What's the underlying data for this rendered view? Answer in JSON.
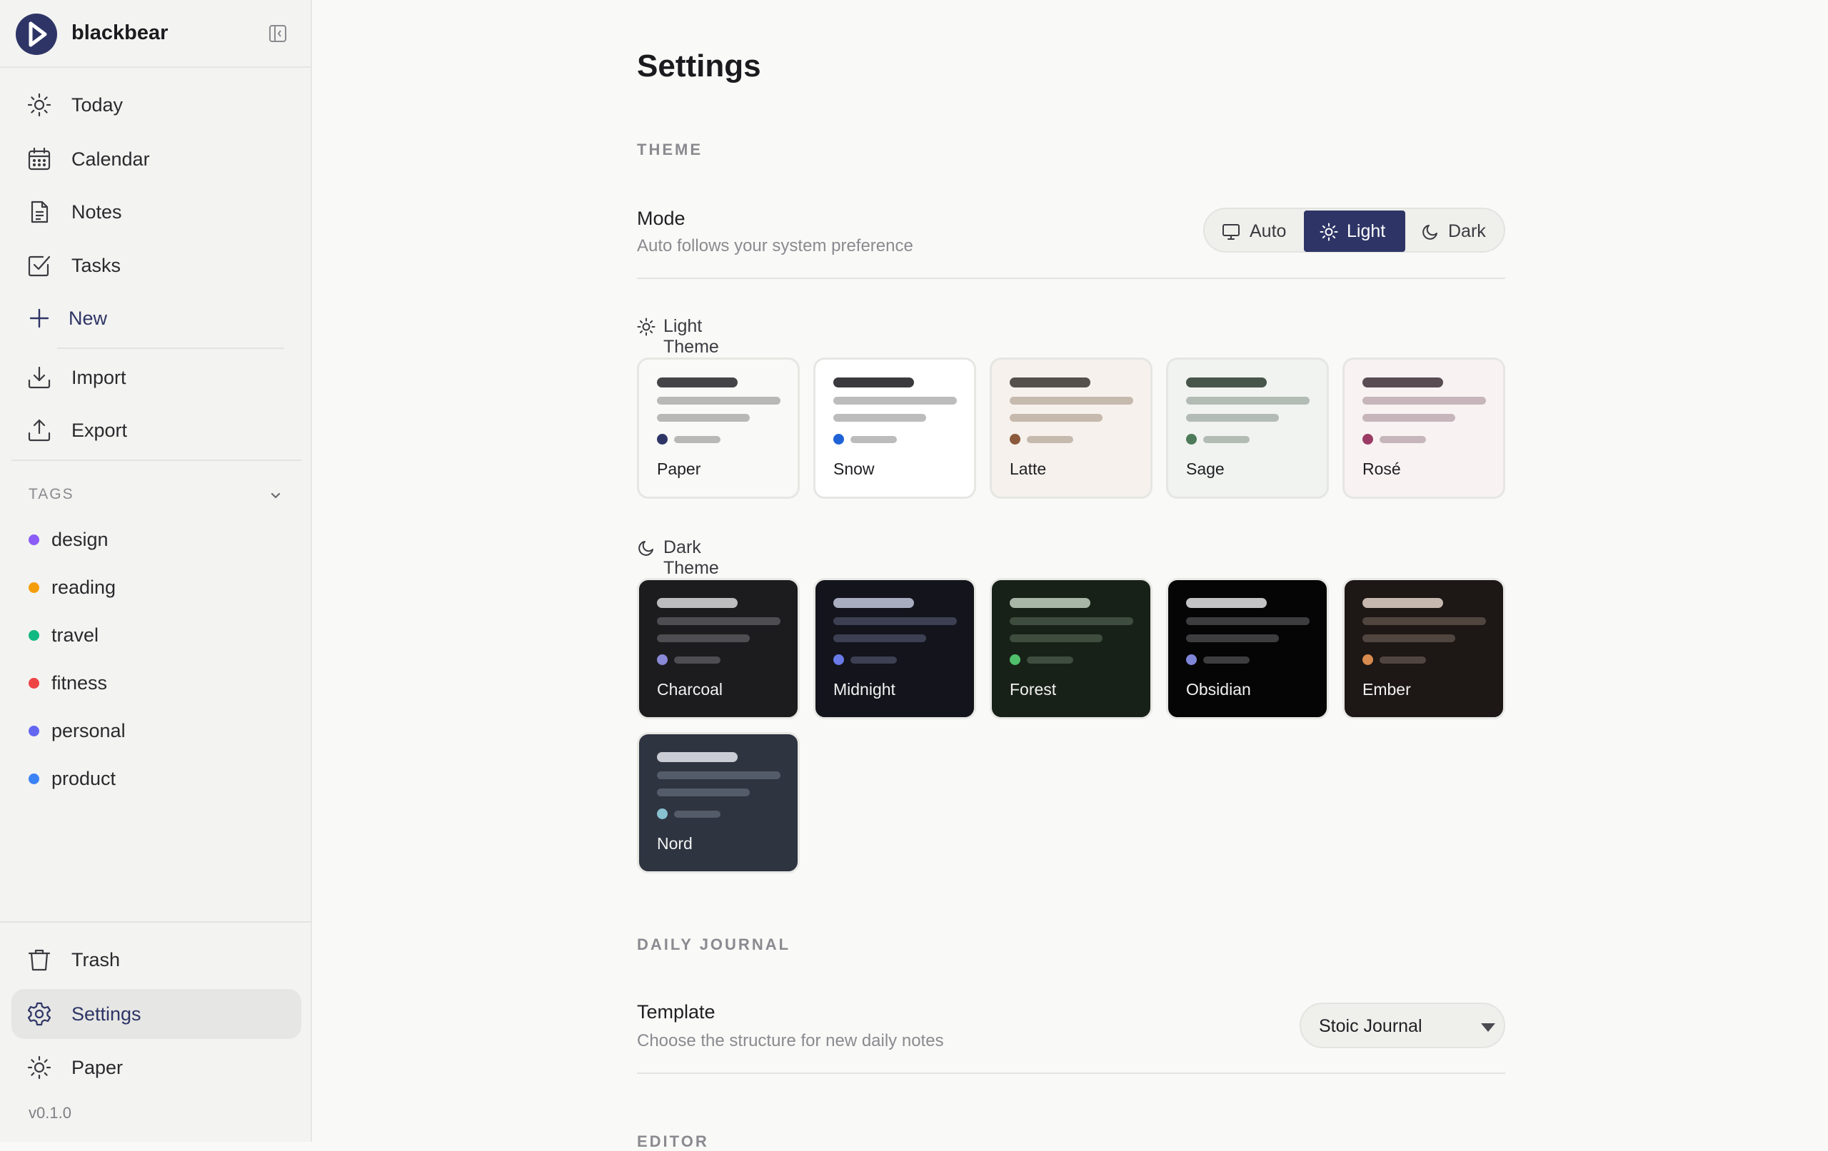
{
  "app": {
    "name": "blackbear",
    "version": "v0.1.0"
  },
  "sidebar": {
    "nav": [
      {
        "label": "Today",
        "icon": "sun-icon"
      },
      {
        "label": "Calendar",
        "icon": "calendar-icon"
      },
      {
        "label": "Notes",
        "icon": "document-icon"
      },
      {
        "label": "Tasks",
        "icon": "checkbox-icon"
      },
      {
        "label": "New",
        "icon": "plus-icon"
      },
      {
        "label": "Import",
        "icon": "download-icon"
      },
      {
        "label": "Export",
        "icon": "upload-icon"
      }
    ],
    "tags_header": "TAGS",
    "tags": [
      {
        "label": "design",
        "color": "#8b5cf6"
      },
      {
        "label": "reading",
        "color": "#f59e0b"
      },
      {
        "label": "travel",
        "color": "#10b981"
      },
      {
        "label": "fitness",
        "color": "#ef4444"
      },
      {
        "label": "personal",
        "color": "#6366f1"
      },
      {
        "label": "product",
        "color": "#3b82f6"
      }
    ],
    "footer": [
      {
        "label": "Trash",
        "icon": "trash-icon"
      },
      {
        "label": "Settings",
        "icon": "gear-icon",
        "active": true
      },
      {
        "label": "Paper",
        "icon": "sun-icon"
      }
    ]
  },
  "main": {
    "title": "Settings",
    "theme_section": "THEME",
    "mode": {
      "title": "Mode",
      "description": "Auto follows your system preference",
      "options": [
        "Auto",
        "Light",
        "Dark"
      ],
      "selected": "Light"
    },
    "light_theme_label": "Light Theme",
    "light_themes": [
      {
        "name": "Paper",
        "bg": "#f9f9f7",
        "bar": "#444448",
        "line": "#b8b8b6",
        "dot": "#2e3566",
        "selected": true
      },
      {
        "name": "Snow",
        "bg": "#ffffff",
        "bar": "#3a3a3e",
        "line": "#bcbcbc",
        "dot": "#1f62d6"
      },
      {
        "name": "Latte",
        "bg": "#f6f1ec",
        "bar": "#55504b",
        "line": "#c6b9ad",
        "dot": "#8b5a3c"
      },
      {
        "name": "Sage",
        "bg": "#f1f3f0",
        "bar": "#48554b",
        "line": "#b3bcb4",
        "dot": "#4d7a58"
      },
      {
        "name": "Rosé",
        "bg": "#f8f2f3",
        "bar": "#594c52",
        "line": "#c6b6bc",
        "dot": "#9b3b64"
      }
    ],
    "dark_theme_label": "Dark Theme",
    "dark_themes": [
      {
        "name": "Charcoal",
        "bg": "#1c1c1e",
        "bar": "#bdbdc0",
        "line": "#4e4e52",
        "dot": "#8a8ad8"
      },
      {
        "name": "Midnight",
        "bg": "#13141c",
        "bar": "#a9adc0",
        "line": "#3d4052",
        "dot": "#6a7ae8"
      },
      {
        "name": "Forest",
        "bg": "#182118",
        "bar": "#a7b6a6",
        "line": "#3e4d3e",
        "dot": "#4fbf6c"
      },
      {
        "name": "Obsidian",
        "bg": "#050505",
        "bar": "#c3c3c5",
        "line": "#3d3d3f",
        "dot": "#7f86d8"
      },
      {
        "name": "Ember",
        "bg": "#1d1715",
        "bar": "#c6b8ae",
        "line": "#514540",
        "dot": "#d98a4e"
      },
      {
        "name": "Nord",
        "bg": "#2e3440",
        "bar": "#c9ccd3",
        "line": "#545b69",
        "dot": "#88c0d0"
      }
    ],
    "journal_section": "DAILY JOURNAL",
    "template": {
      "title": "Template",
      "description": "Choose the structure for new daily notes",
      "value": "Stoic Journal"
    },
    "editor_section": "EDITOR"
  },
  "colors": {
    "accent": "#2e3566",
    "background": "#f9f9f7",
    "sidebar": "#f3f3f1"
  }
}
